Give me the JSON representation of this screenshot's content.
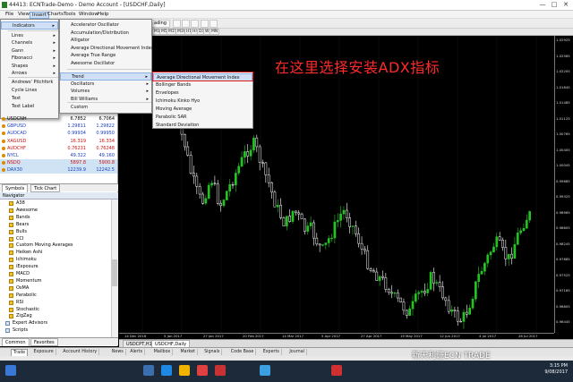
{
  "window": {
    "title": "44413: ECNTrade-Demo - Demo Account - [USDCHF,Daily]",
    "min": "—",
    "max": "□",
    "close": "✕"
  },
  "menubar": [
    "File",
    "View",
    "Insert",
    "Charts",
    "Tools",
    "Window",
    "Help"
  ],
  "toolbar": {
    "autotrading": "ading"
  },
  "timeframes": [
    "M1",
    "M5",
    "M15",
    "M30",
    "H1",
    "H4",
    "D1",
    "W1",
    "MN"
  ],
  "insert_menu": {
    "items": [
      {
        "label": "Indicators",
        "arrow": "▸"
      },
      {
        "label": "Lines",
        "arrow": "▸"
      },
      {
        "label": "Channels",
        "arrow": "▸"
      },
      {
        "label": "Gann",
        "arrow": "▸"
      },
      {
        "label": "Fibonacci",
        "arrow": "▸"
      },
      {
        "label": "Shapes",
        "arrow": "▸"
      },
      {
        "label": "Arrows",
        "arrow": "▸"
      },
      {
        "label": "Andrews' Pitchfork",
        "arrow": ""
      },
      {
        "label": "Cycle Lines",
        "arrow": ""
      },
      {
        "label": "Text",
        "arrow": ""
      },
      {
        "label": "Text Label",
        "arrow": ""
      }
    ]
  },
  "indicators_menu": {
    "items": [
      "Accelerator Oscillator",
      "Accumulation/Distribution",
      "Alligator",
      "Average Directional Movement Index",
      "Average True Range",
      "Awesome Oscillator",
      "Trend",
      "Oscillators",
      "Volumes",
      "Bill Williams",
      "Custom"
    ],
    "arrow": "▸"
  },
  "trend_menu": {
    "items": [
      "Average Directional Movement Index",
      "Bollinger Bands",
      "Envelopes",
      "Ichimoku Kinko Hyo",
      "Moving Average",
      "Parabolic SAR",
      "Standard Deviation"
    ]
  },
  "market_watch": {
    "rows": [
      {
        "symbol": "USDCNH",
        "bid": "6.7852",
        "ask": "6.7064",
        "color": "#000000"
      },
      {
        "symbol": "GBPUSD",
        "bid": "1.29811",
        "ask": "1.29822",
        "color": "#1a3fbf"
      },
      {
        "symbol": "AUDCAD",
        "bid": "0.99934",
        "ask": "0.99950",
        "color": "#1a3fbf"
      },
      {
        "symbol": "XAGUSD",
        "bid": "16.319",
        "ask": "16.334",
        "color": "#d01010"
      },
      {
        "symbol": "AUDCHF",
        "bid": "0.76231",
        "ask": "0.76248",
        "color": "#d01010"
      },
      {
        "symbol": "NYCL",
        "bid": "49.322",
        "ask": "49.160",
        "color": "#1a3fbf"
      },
      {
        "symbol": "NSDQ",
        "bid": "5897.8",
        "ask": "5900.8",
        "color": "#d01010"
      },
      {
        "symbol": "DAX30",
        "bid": "12239.9",
        "ask": "12242.5",
        "color": "#1a3fbf"
      }
    ],
    "tabs": [
      "Symbols",
      "Tick Chart"
    ]
  },
  "navigator": {
    "title": "Navigator",
    "items": [
      "A38",
      "Awesome",
      "Bands",
      "Bears",
      "Bulls",
      "CCI",
      "Custom Moving Averages",
      "Heiken Ashi",
      "Ichimoku",
      "iExposure",
      "MACD",
      "Momentum",
      "OsMA",
      "Parabolic",
      "RSI",
      "Stochastic",
      "ZigZag",
      "Expert Advisors",
      "Scripts"
    ],
    "tabs": [
      "Common",
      "Favorites"
    ]
  },
  "price_axis": [
    "1.02925",
    "1.02565",
    "1.02205",
    "1.01845",
    "1.01485",
    "1.01125",
    "1.00765",
    "1.00405",
    "1.00045",
    "0.99685",
    "0.99325",
    "0.98965",
    "0.98605",
    "0.98245",
    "0.97885",
    "0.97525",
    "0.97165",
    "0.96805",
    "0.96445"
  ],
  "time_axis": [
    "14 Dec 2016",
    "5 Jan 2017",
    "27 Jan 2017",
    "20 Feb 2017",
    "14 Mar 2017",
    "5 Apr 2017",
    "27 Apr 2017",
    "19 May 2017",
    "12 Jun 2017",
    "4 Jul 2017",
    "26 Jul 2017"
  ],
  "chart_tabs": [
    "USDCPT,H1",
    "USDCHF,Daily"
  ],
  "terminal_tabs": [
    "Trade",
    "Exposure",
    "Account History",
    "News",
    "Alerts",
    "Mailbox",
    "Market",
    "Signals",
    "Code Base",
    "Experts",
    "Journal"
  ],
  "annotation": "在这里选择安装ADX指标",
  "watermark": "新天利证ECN TRADE",
  "clock": {
    "time": "3:15 PM",
    "date": "9/08/2017"
  },
  "colors": {
    "bull": "#22c322",
    "bear": "#ffffff",
    "annotation": "#ff2a2a"
  }
}
